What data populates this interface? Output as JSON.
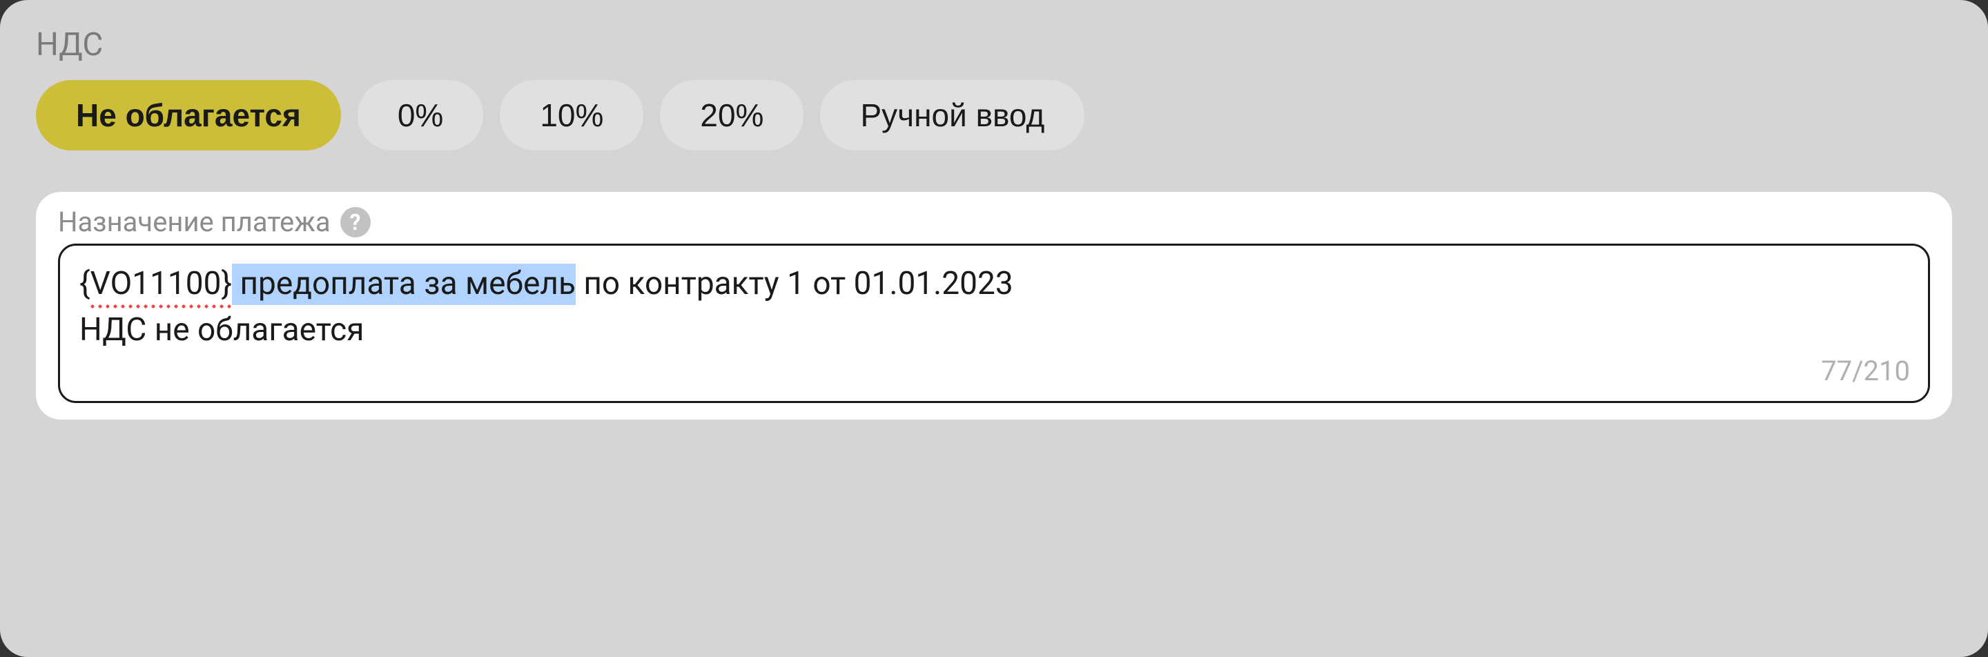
{
  "vat": {
    "label": "НДС",
    "options": [
      "Не облагается",
      "0%",
      "10%",
      "20%",
      "Ручной ввод"
    ],
    "active_index": 0
  },
  "purpose": {
    "label": "Назначение платежа",
    "help": "?",
    "vo_code": "{VO11100}",
    "highlighted": " предоплата за мебель",
    "rest_line1": " по контракту 1 от 01.01.2023",
    "line2": "НДС не облагается",
    "counter": "77/210"
  }
}
